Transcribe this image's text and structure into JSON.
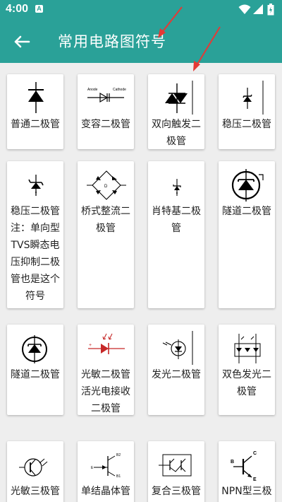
{
  "status": {
    "time": "4:00",
    "notification": "A"
  },
  "appbar": {
    "title": "常用电路图符号",
    "back_icon": "arrow-left-icon"
  },
  "colors": {
    "primary": "#2aa198",
    "annotation_arrow": "#e53935"
  },
  "items": [
    {
      "label": "普通二极管",
      "icon": "diode-symbol-icon"
    },
    {
      "label": "变容二极管",
      "icon": "varactor-diode-symbol-icon",
      "anode_text": "Anode",
      "cathode_text": "Cathode"
    },
    {
      "label": "双向触发二极管",
      "icon": "diac-symbol-icon"
    },
    {
      "label": "稳压二极管",
      "icon": "zener-diode-symbol-icon"
    },
    {
      "label": "稳压二极管 注：单向型TVS瞬态电压抑制二极管也是这个符号",
      "icon": "tvs-diode-symbol-icon"
    },
    {
      "label": "桥式整流二极管",
      "icon": "bridge-rectifier-symbol-icon",
      "center_text": "D"
    },
    {
      "label": "肖特基二极管",
      "icon": "schottky-diode-symbol-icon"
    },
    {
      "label": "隧道二极管",
      "icon": "tunnel-diode-circle-symbol-icon"
    },
    {
      "label": "隧道二极管",
      "icon": "tunnel-diode-symbol-icon"
    },
    {
      "label": "光敏二极管活光电接收二极管",
      "icon": "photodiode-symbol-icon"
    },
    {
      "label": "发光二极管",
      "icon": "led-symbol-icon"
    },
    {
      "label": "双色发光二极管",
      "icon": "bicolor-led-symbol-icon"
    },
    {
      "label": "光敏三极管或光电",
      "icon": "phototransistor-symbol-icon"
    },
    {
      "label": "单结晶体管（双基",
      "icon": "ujt-symbol-icon"
    },
    {
      "label": "复合三极管",
      "icon": "darlington-transistor-symbol-icon"
    },
    {
      "label": "NPN型三极管",
      "icon": "npn-transistor-symbol-icon",
      "b_text": "B",
      "c_text": "C",
      "e_text": "E"
    }
  ]
}
